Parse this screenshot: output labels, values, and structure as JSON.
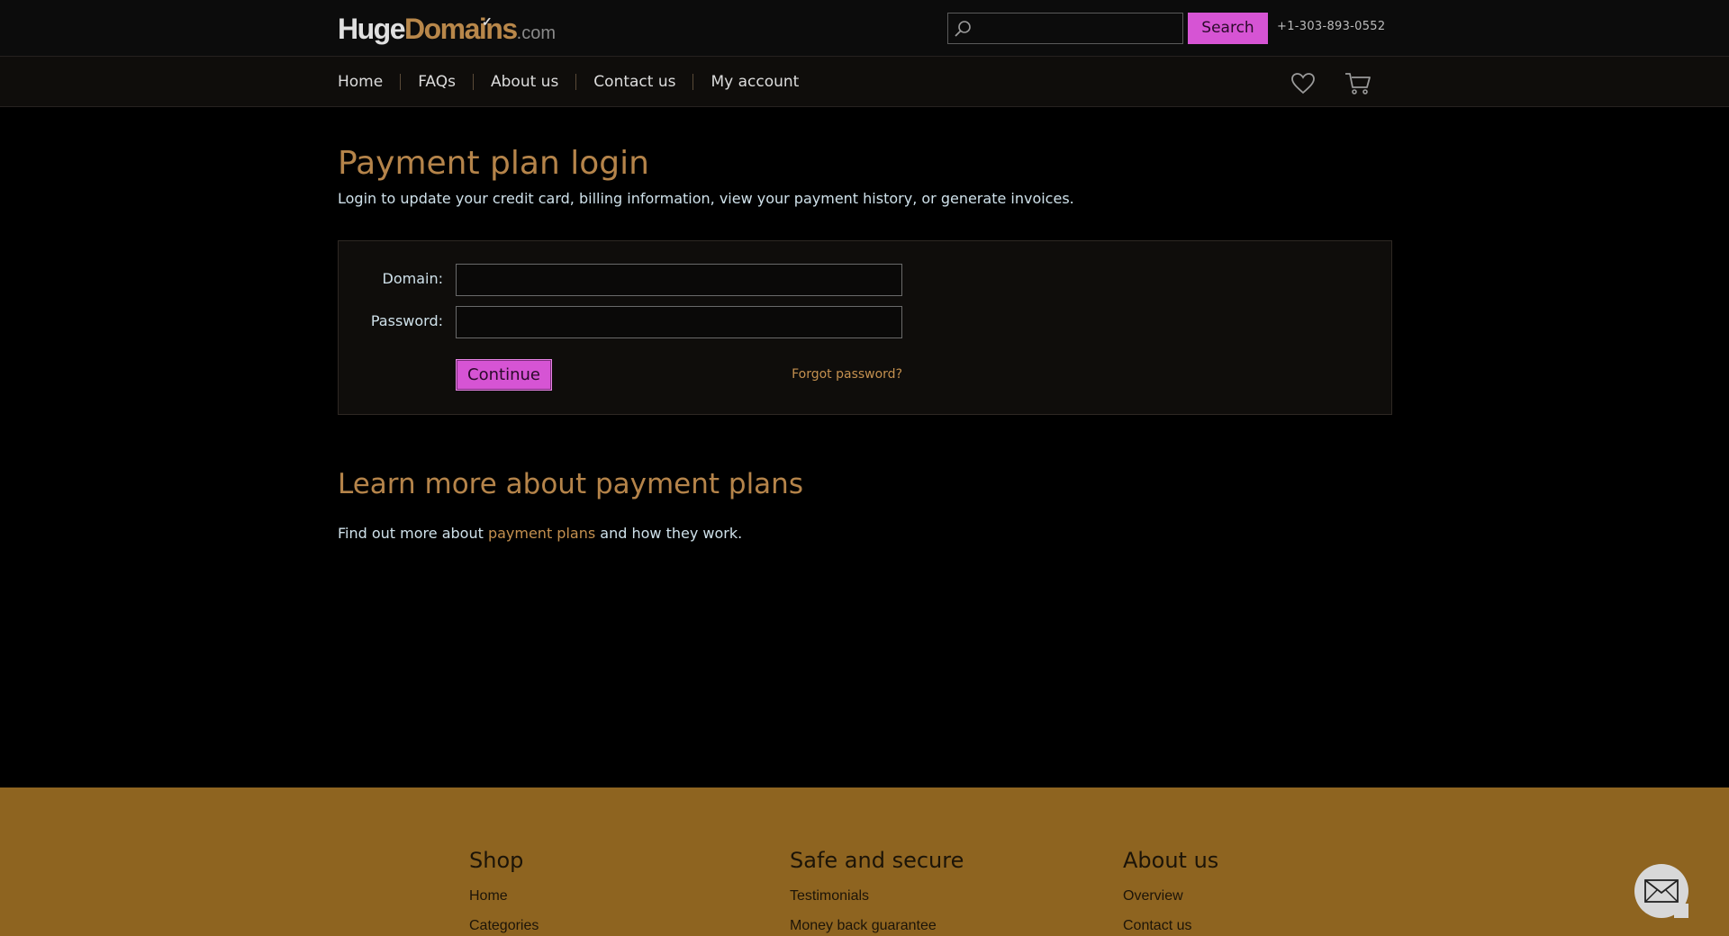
{
  "header": {
    "logo": {
      "part1": "Huge",
      "part2": "Domains",
      "part3": ".com",
      "check": "✓"
    },
    "search": {
      "placeholder": "",
      "button_label": "Search"
    },
    "phone": "+1-303-893-0552"
  },
  "nav": {
    "items": [
      {
        "label": "Home"
      },
      {
        "label": "FAQs"
      },
      {
        "label": "About us"
      },
      {
        "label": "Contact us"
      },
      {
        "label": "My account"
      }
    ],
    "icons": [
      "heart-icon",
      "cart-icon"
    ]
  },
  "main": {
    "title": "Payment plan login",
    "intro": "Login to update your credit card, billing information, view your payment history, or generate invoices.",
    "form": {
      "domain_label": "Domain:",
      "domain_value": "",
      "password_label": "Password:",
      "password_value": "",
      "continue_label": "Continue",
      "forgot_label": "Forgot password?"
    },
    "learn_more": {
      "title": "Learn more about payment plans",
      "text_before": "Find out more about ",
      "link": "payment plans",
      "text_after": " and how they work."
    }
  },
  "footer": {
    "columns": [
      {
        "heading": "Shop",
        "links": [
          "Home",
          "Categories"
        ]
      },
      {
        "heading": "Safe and secure",
        "links": [
          "Testimonials",
          "Money back guarantee"
        ]
      },
      {
        "heading": "About us",
        "links": [
          "Overview",
          "Contact us"
        ]
      }
    ]
  },
  "chat": {
    "icon": "mail-icon"
  },
  "colors": {
    "accent_pink": "#d654d4",
    "brand_gold": "#b5844a",
    "footer_bg": "#8e6420",
    "page_bg": "#000000"
  }
}
